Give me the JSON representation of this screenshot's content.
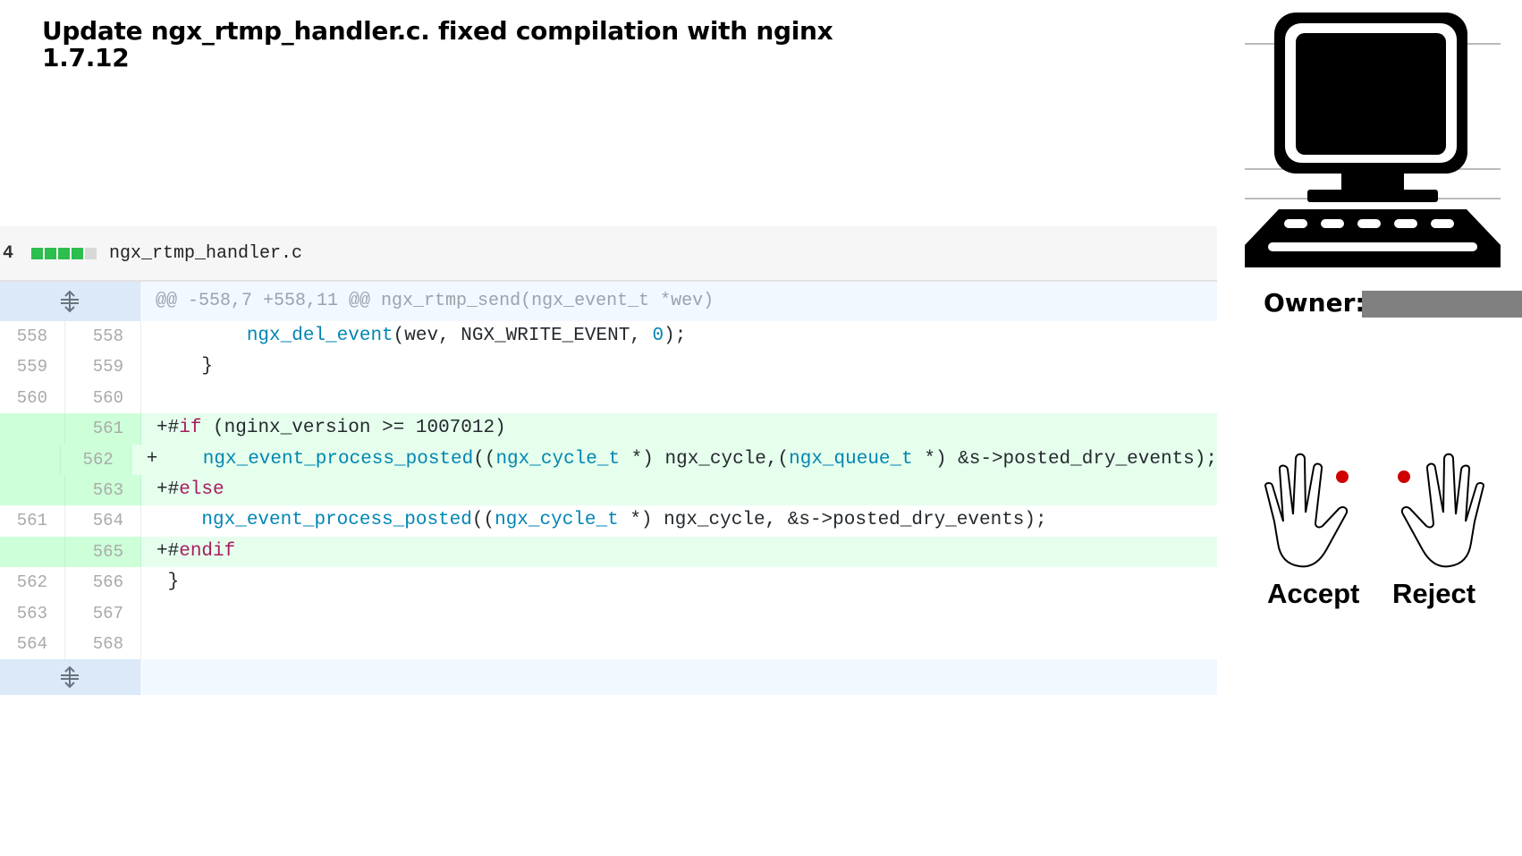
{
  "title": "Update ngx_rtmp_handler.c. fixed compilation with nginx 1.7.12",
  "file": {
    "change_count": "4",
    "name": "ngx_rtmp_handler.c",
    "stat": [
      "add",
      "add",
      "add",
      "add",
      "neutral"
    ]
  },
  "hunk_header": "@@ -558,7 +558,11 @@ ngx_rtmp_send(ngx_event_t *wev)",
  "lines": [
    {
      "old": "558",
      "new": "558",
      "type": "context",
      "code": "        ngx_del_event(wev, NGX_WRITE_EVENT, 0);"
    },
    {
      "old": "559",
      "new": "559",
      "type": "context",
      "code": "    }"
    },
    {
      "old": "560",
      "new": "560",
      "type": "context",
      "code": ""
    },
    {
      "old": "",
      "new": "561",
      "type": "added",
      "code": "+#if (nginx_version >= 1007012)"
    },
    {
      "old": "",
      "new": "562",
      "type": "added",
      "code": "+    ngx_event_process_posted((ngx_cycle_t *) ngx_cycle,(ngx_queue_t *) &s->posted_dry_events);"
    },
    {
      "old": "",
      "new": "563",
      "type": "added",
      "code": "+#else"
    },
    {
      "old": "561",
      "new": "564",
      "type": "context",
      "code": "    ngx_event_process_posted((ngx_cycle_t *) ngx_cycle, &s->posted_dry_events);"
    },
    {
      "old": "",
      "new": "565",
      "type": "added",
      "code": "+#endif"
    },
    {
      "old": "562",
      "new": "566",
      "type": "context",
      "code": " }"
    },
    {
      "old": "563",
      "new": "567",
      "type": "context",
      "code": ""
    },
    {
      "old": "564",
      "new": "568",
      "type": "context",
      "code": ""
    }
  ],
  "sidebar": {
    "owner_label": "Owner:",
    "accept_label": "Accept",
    "reject_label": "Reject"
  },
  "icons": {
    "computer": "computer-icon",
    "expand": "expand-icon",
    "left_hand": "left-hand-icon",
    "right_hand": "right-hand-icon"
  },
  "colors": {
    "added_bg": "#e6ffed",
    "added_gutter": "#cdffd8",
    "hunk_bg": "#f1f8ff",
    "stat_add": "#2cbe4e",
    "owner_bar": "#808080",
    "finger_dot": "#d10000"
  }
}
